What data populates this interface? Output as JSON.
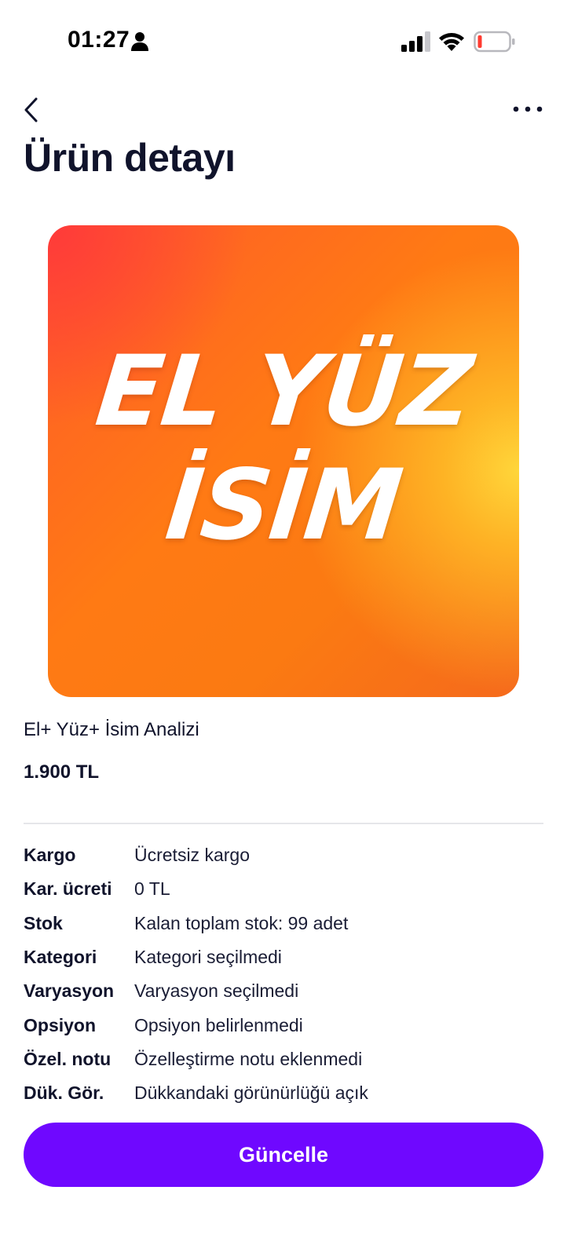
{
  "status_bar": {
    "time": "01:27",
    "icons": [
      "person-icon",
      "signal-icon",
      "wifi-icon",
      "battery-icon"
    ],
    "battery_level": 0.1,
    "battery_color": "#ff3b30"
  },
  "header": {
    "back_icon": "chevron-left-icon",
    "more_icon": "more-horizontal-icon",
    "title": "Ürün detayı"
  },
  "product": {
    "image_text_line1": "EL YÜZ",
    "image_text_line2": "İSİM",
    "name": "El+ Yüz+ İsim Analizi",
    "price": "1.900 TL"
  },
  "details": [
    {
      "label": "Kargo",
      "value": "Ücretsiz kargo"
    },
    {
      "label": "Kar. ücreti",
      "value": "0 TL"
    },
    {
      "label": "Stok",
      "value": "Kalan toplam stok: 99 adet"
    },
    {
      "label": "Kategori",
      "value": "Kategori seçilmedi"
    },
    {
      "label": "Varyasyon",
      "value": "Varyasyon seçilmedi"
    },
    {
      "label": "Opsiyon",
      "value": "Opsiyon belirlenmedi"
    },
    {
      "label": "Özel. notu",
      "value": "Özelleştirme notu eklenmedi"
    },
    {
      "label": "Dük. Gör.",
      "value": "Dükkandaki görünürlüğü açık"
    }
  ],
  "actions": {
    "update_label": "Güncelle"
  },
  "colors": {
    "primary": "#6f08ff",
    "text": "#10132b",
    "image_orange": "#ff7a14",
    "image_yellow": "#ffd63a",
    "image_red": "#ff3a3a"
  }
}
